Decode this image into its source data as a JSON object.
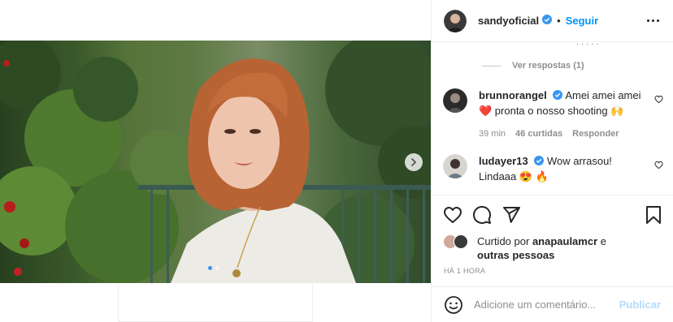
{
  "post": {
    "carousel": {
      "total_slides": 2,
      "active_slide": 1
    }
  },
  "header": {
    "username": "sandyoficial",
    "separator": "•",
    "follow_label": "Seguir"
  },
  "comments_section": {
    "view_replies_label": "Ver respostas (1)",
    "comments": [
      {
        "username": "brunnorangel",
        "text": "Amei amei amei ❤️ pronta o nosso shooting 🙌",
        "time": "39 min",
        "likes": "46 curtidas",
        "reply_label": "Responder"
      },
      {
        "username": "ludayer13",
        "text": "Wow arrasou! Lindaaa 😍 🔥"
      }
    ]
  },
  "likes_summary": {
    "prefix": "Curtido por",
    "user": "anapaulamcr",
    "suffix": "e",
    "others": "outras pessoas"
  },
  "time_ago": "HÁ 1 HORA",
  "add_comment": {
    "placeholder": "Adicione um comentário...",
    "publish_label": "Publicar"
  },
  "colors": {
    "accent": "#0095f6",
    "publish_disabled": "#b3dbff",
    "verified": "#3897f0",
    "heart": "#ed4956"
  },
  "icons": [
    "next-arrow-icon",
    "verified-badge-icon",
    "more-options-icon",
    "heart-icon",
    "comment-icon",
    "share-icon",
    "bookmark-icon",
    "emoji-icon"
  ]
}
